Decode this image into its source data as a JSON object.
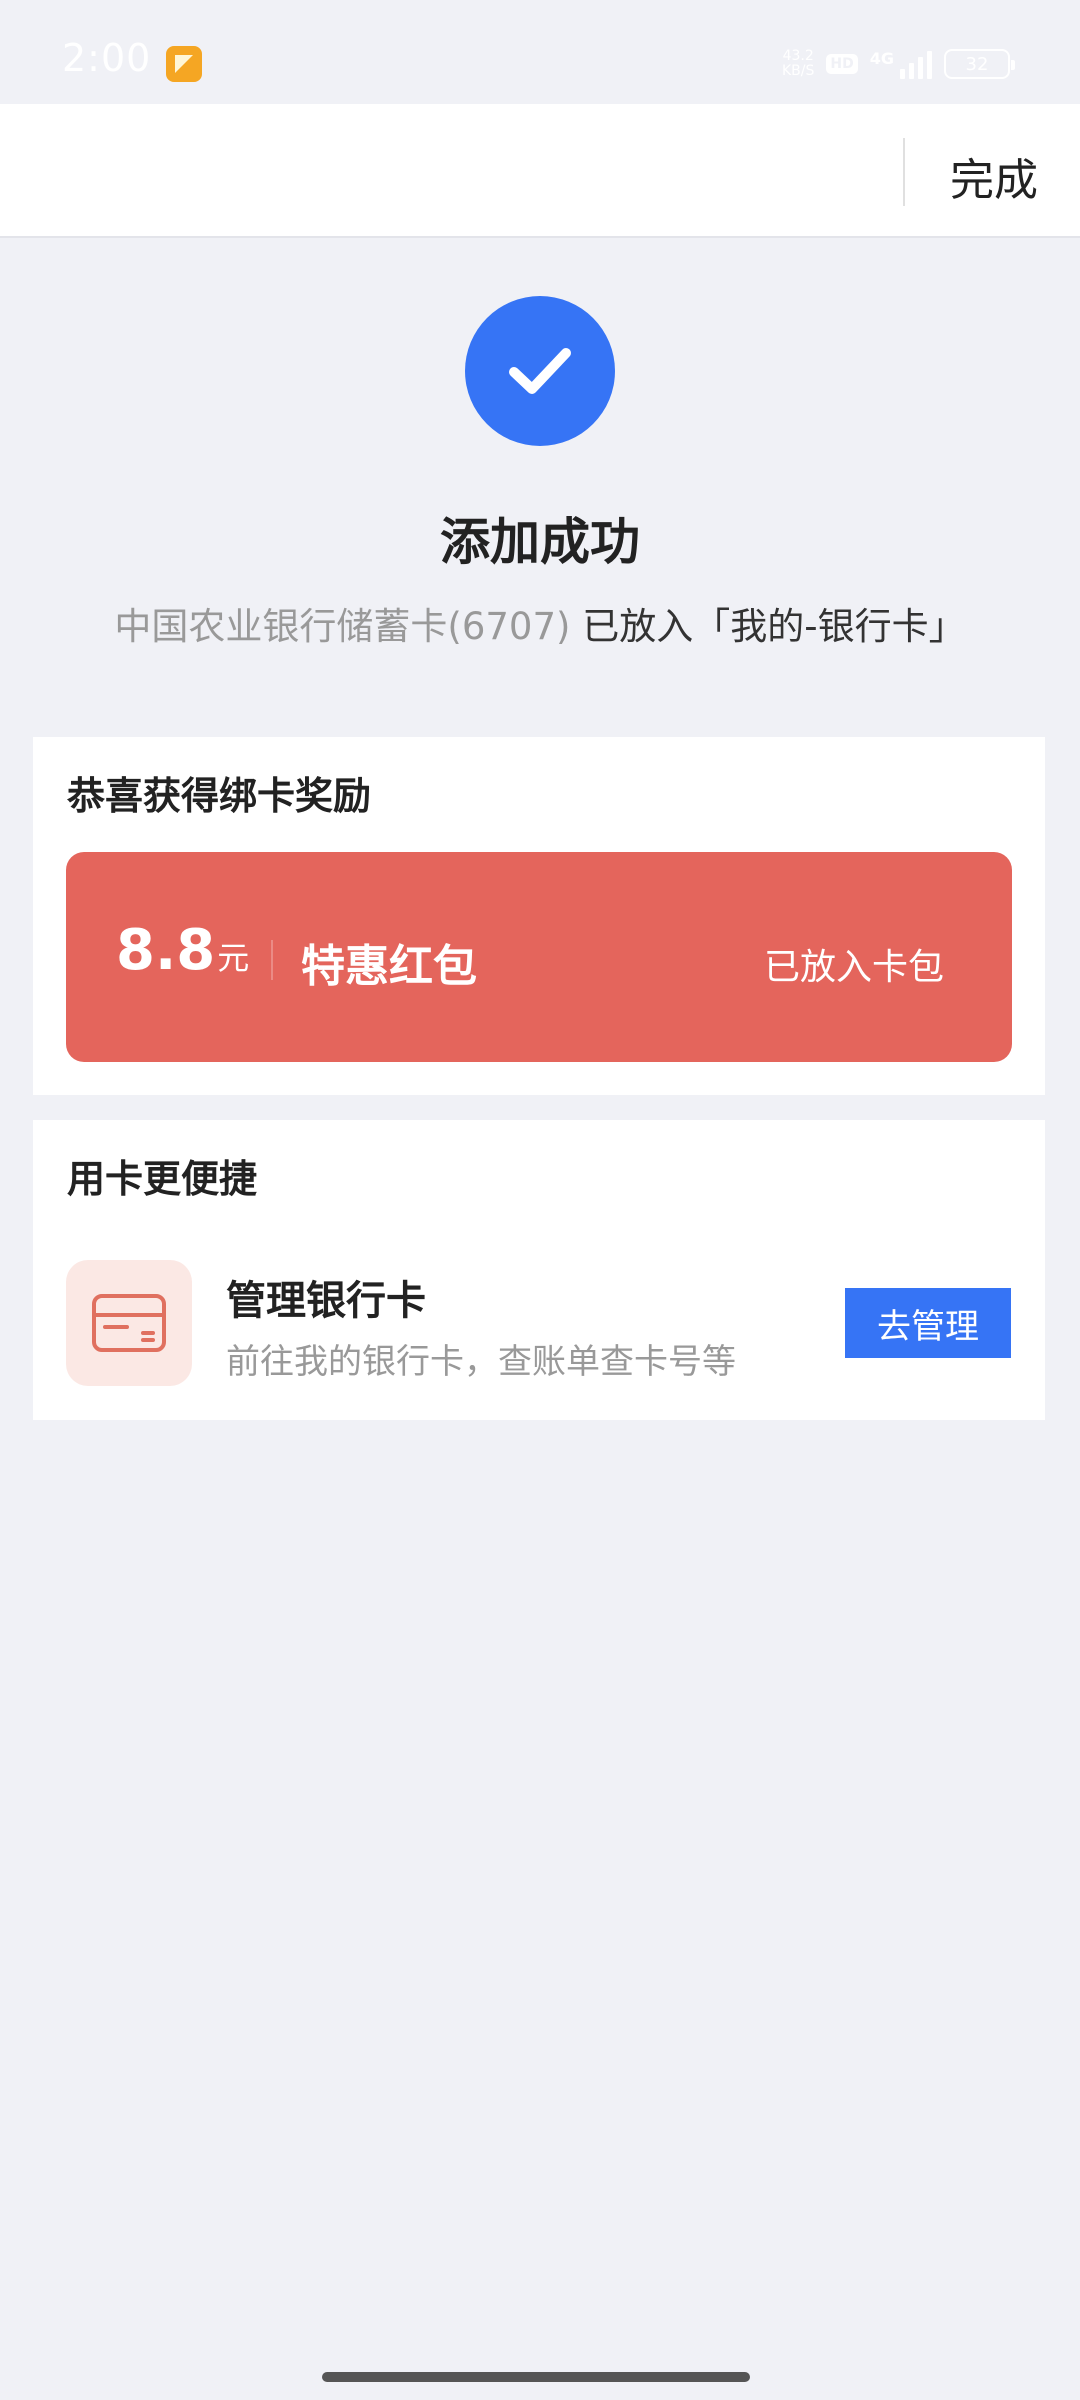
{
  "status_bar": {
    "time": "2:00",
    "net_speed_value": "43.2",
    "net_speed_unit": "KB/S",
    "hd_label": "HD",
    "network_type": "4G",
    "battery": "32"
  },
  "nav": {
    "done_label": "完成"
  },
  "result": {
    "title": "添加成功",
    "card_name": "中国农业银行储蓄卡(6707)",
    "placed_text": "已放入「我的-银行卡」"
  },
  "reward": {
    "section_title": "恭喜获得绑卡奖励",
    "amount": "8.8",
    "unit": "元",
    "name": "特惠红包",
    "status": "已放入卡包"
  },
  "shortcut": {
    "section_title": "用卡更便捷",
    "item_title": "管理银行卡",
    "item_desc": "前往我的银行卡，查账单查卡号等",
    "button_label": "去管理"
  },
  "colors": {
    "accent": "#3674f5",
    "red_packet": "#e4655c",
    "background": "#f0f1f6"
  }
}
